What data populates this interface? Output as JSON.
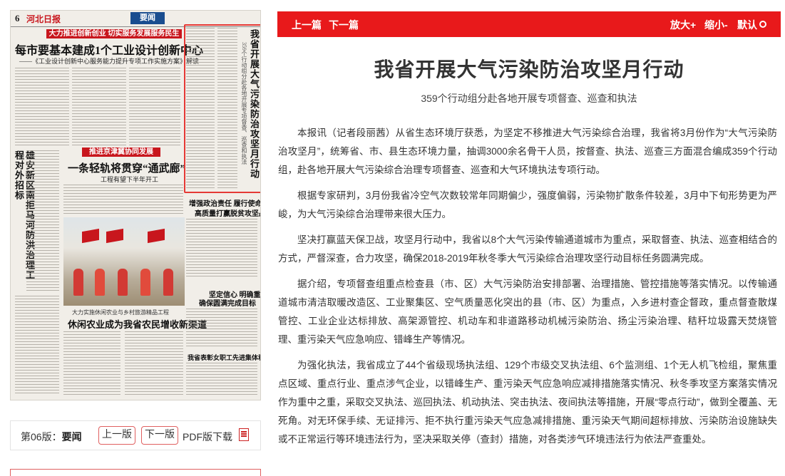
{
  "paper": {
    "page_number": "6",
    "logo": "河北日报",
    "section": "要闻",
    "banner_top": "大力推进创新创业 切实服务发展服务民生",
    "headline_main": "每市要基本建成1个工业设计创新中心",
    "headline_main_sub": "——《工业设计创新中心服务能力提升专项工作实施方案》解读",
    "banner_mid": "推进京津冀协同发展",
    "headline_mid": "一条轻轨将贯穿“通武廊”",
    "headline_mid_sub": "工程有望下半年开工",
    "vertical_left": "雄安新区南拒马河防洪治理工程对外招标",
    "highlight_title": "我省开展大气污染防治攻坚月行动",
    "highlight_sub": "359个行动组分赴各地开展专项督查、巡查和执法",
    "right_head1": "增强政治责任 履行使命担当",
    "right_head2": "高质量打赢脱贫攻坚战",
    "right_head3": "坚定信心 明确重点",
    "right_head4": "确保圆满完成目标",
    "bottom_head": "休闲农业成为我省农民增收新渠道",
    "bottom_kicker": "大力实施休闲农业与乡村旅游精品工程",
    "bottom_right": "我省表彰女职工先进集体和个人"
  },
  "page_nav": {
    "label": "第06版：",
    "page_name": "要闻",
    "prev_page": "上一版",
    "next_page": "下一版",
    "pdf_download": "PDF版下载"
  },
  "toolbar": {
    "prev_article": "上一篇",
    "next_article": "下一篇",
    "zoom_in": "放大+",
    "zoom_out": "缩小-",
    "default_size": "默认"
  },
  "article": {
    "title": "我省开展大气污染防治攻坚月行动",
    "subtitle": "359个行动组分赴各地开展专项督查、巡查和执法",
    "paragraphs": [
      "本报讯（记者段丽茜）从省生态环境厅获悉，为坚定不移推进大气污染综合治理，我省将3月份作为“大气污染防治攻坚月”，统筹省、市、县生态环境力量，抽调3000余名骨干人员，按督查、执法、巡查三方面混合编成359个行动组，赴各地开展大气污染综合治理专项督查、巡查和大气环境执法专项行动。",
      "根据专家研判，3月份我省冷空气次数较常年同期偏少，强度偏弱，污染物扩散条件较差，3月中下旬形势更为严峻，为大气污染综合治理带来很大压力。",
      "坚决打赢蓝天保卫战，攻坚月行动中，我省以8个大气污染传输通道城市为重点，采取督查、执法、巡查相结合的方式，严督深查，合力攻坚，确保2018-2019年秋冬季大气污染综合治理攻坚行动目标任务圆满完成。",
      "据介绍，专项督查组重点检查县（市、区）大气污染防治安排部署、治理措施、管控措施等落实情况。以传输通道城市清洁取暖改造区、工业聚集区、空气质量恶化突出的县（市、区）为重点，入乡进村查企督政，重点督查散煤管控、工业企业达标排放、高架源管控、机动车和非道路移动机械污染防治、扬尘污染治理、秸秆垃圾露天焚烧管理、重污染天气应急响应、错峰生产等情况。",
      "为强化执法，我省成立了44个省级现场执法组、129个市级交叉执法组、6个监测组、1个无人机飞检组，聚焦重点区域、重点行业、重点涉气企业，以错峰生产、重污染天气应急响应减排措施落实情况、秋冬季攻坚方案落实情况作为重中之重，采取交叉执法、巡回执法、机动执法、突击执法、夜间执法等措施，开展“零点行动”，做到全覆盖、无死角。对无环保手续、无证排污、拒不执行重污染天气应急减排措施、重污染天气期间超标排放、污染防治设施缺失或不正常运行等环境违法行为，坚决采取关停（查封）措施，对各类涉气环境违法行为依法严查重处。"
    ]
  },
  "colors": {
    "accent_red": "#e8191b",
    "highlight_border": "#e53935",
    "paper_bg": "#f1eee8",
    "section_blue": "#1a4d8f"
  }
}
